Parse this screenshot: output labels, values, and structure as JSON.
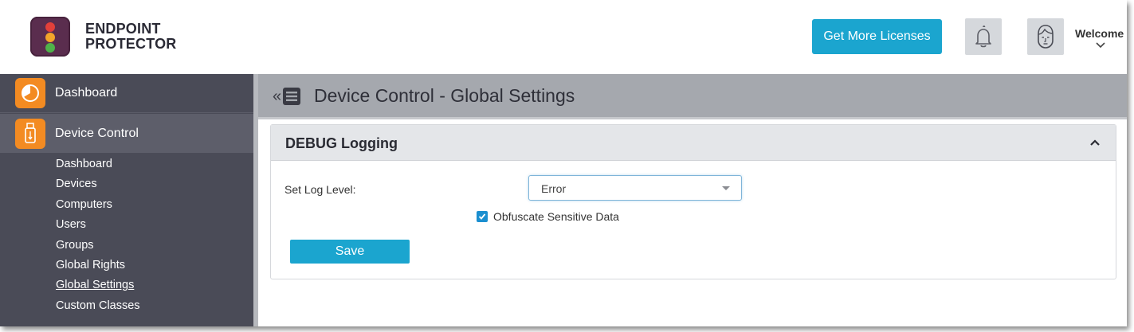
{
  "header": {
    "brand_line1": "ENDPOINT",
    "brand_line2": "PROTECTOR",
    "get_licenses_label": "Get More Licenses",
    "welcome_label": "Welcome"
  },
  "sidebar": {
    "main_items": [
      {
        "label": "Dashboard",
        "icon": "dashboard-pie-icon"
      },
      {
        "label": "Device Control",
        "icon": "usb-drive-icon"
      }
    ],
    "sub_items": [
      {
        "label": "Dashboard"
      },
      {
        "label": "Devices"
      },
      {
        "label": "Computers"
      },
      {
        "label": "Users"
      },
      {
        "label": "Groups"
      },
      {
        "label": "Global Rights"
      },
      {
        "label": "Global Settings",
        "active": true
      },
      {
        "label": "Custom Classes"
      }
    ]
  },
  "page": {
    "title": "Device Control - Global Settings"
  },
  "panel": {
    "title": "DEBUG Logging",
    "log_level_label": "Set Log Level:",
    "log_level_value": "Error",
    "obfuscate_label": "Obfuscate Sensitive Data",
    "obfuscate_checked": true,
    "save_label": "Save"
  },
  "colors": {
    "accent": "#1ba5cf",
    "sidebar_bg": "#4a4b57",
    "nav_icon_orange": "#f38b22",
    "topbar_bg": "#a5a8ae"
  }
}
